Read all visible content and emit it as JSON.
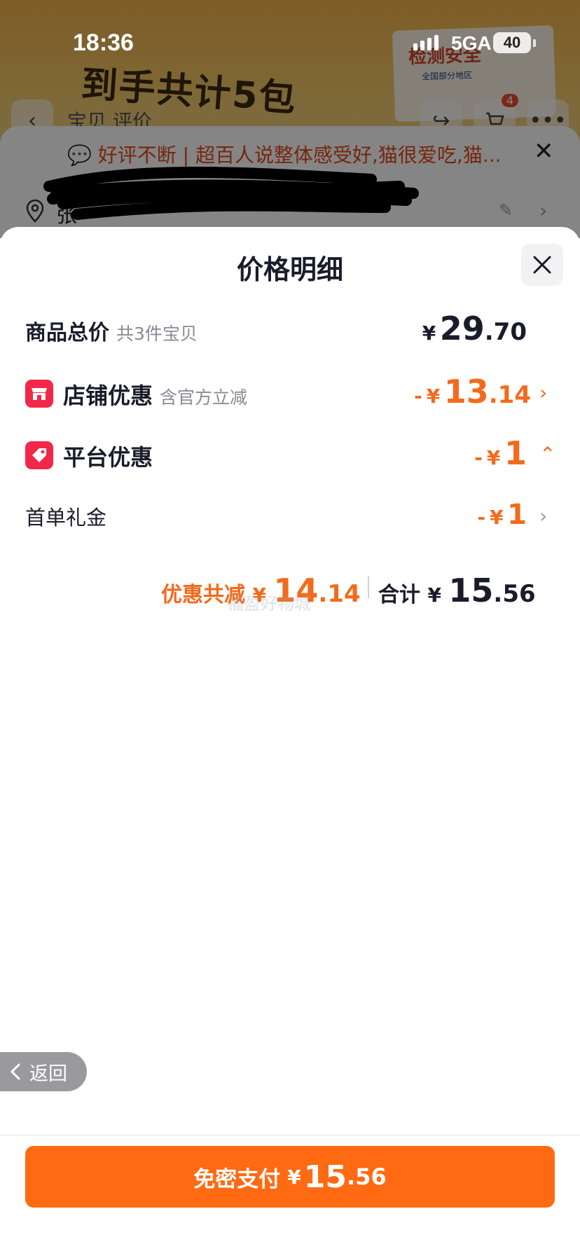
{
  "status_bar": {
    "time": "18:36",
    "network": "5GA",
    "battery": "40"
  },
  "background": {
    "banner_text": "到手共计5包",
    "box_title": "检测安全",
    "box_sub": "全国部分地区",
    "nav_tabs": "宝贝  评价",
    "cart_badge": "4",
    "review_text": "好评不断 | 超百人说整体感受好,猫很爱吃,猫...",
    "address_prefix": "张"
  },
  "sheet": {
    "title": "价格明细",
    "rows": {
      "total": {
        "label": "商品总价",
        "sub": "共3件宝贝",
        "yen": "¥",
        "int": "29",
        "dec": ".70"
      },
      "shop": {
        "label": "店铺优惠",
        "sub": "含官方立减",
        "minus": "-",
        "yen": "¥",
        "int": "13",
        "dec": ".14"
      },
      "platform": {
        "label": "平台优惠",
        "minus": "-",
        "yen": "¥",
        "int": "1"
      },
      "first_order": {
        "label": "首单礼金",
        "minus": "-",
        "yen": "¥",
        "int": "1"
      }
    },
    "summary": {
      "discount_label": "优惠共减",
      "discount_yen": "¥",
      "discount_int": "14",
      "discount_dec": ".14",
      "total_label": "合计",
      "total_yen": "¥",
      "total_int": "15",
      "total_dec": ".56"
    },
    "watermark": "福盈好物城"
  },
  "back_button": {
    "label": "返回"
  },
  "pay_button": {
    "label": "免密支付",
    "yen": "¥",
    "int": "15",
    "dec": ".56"
  },
  "colors": {
    "accent": "#ff6a13",
    "discount": "#f26b1d",
    "icon_red": "#f2284a"
  }
}
